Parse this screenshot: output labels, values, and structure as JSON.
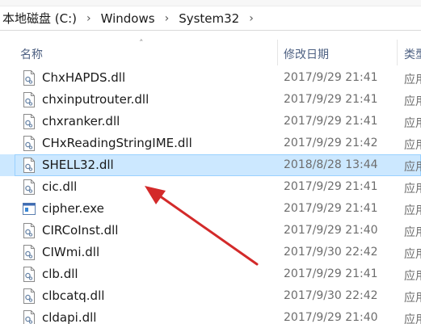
{
  "address": {
    "crumbs": [
      "本地磁盘 (C:)",
      "Windows",
      "System32"
    ]
  },
  "columns": {
    "name": "名称",
    "date": "修改日期",
    "type": "类型"
  },
  "files": [
    {
      "name": "ChxHAPDS.dll",
      "date": "2017/9/29 21:41",
      "type": "应用",
      "icon": "dll-file-icon"
    },
    {
      "name": "chxinputrouter.dll",
      "date": "2017/9/29 21:41",
      "type": "应用",
      "icon": "dll-file-icon"
    },
    {
      "name": "chxranker.dll",
      "date": "2017/9/29 21:41",
      "type": "应用",
      "icon": "dll-file-icon"
    },
    {
      "name": "CHxReadingStringIME.dll",
      "date": "2017/9/29 21:42",
      "type": "应用",
      "icon": "dll-file-icon"
    },
    {
      "name": "SHELL32.dll",
      "date": "2018/8/28 13:44",
      "type": "应用",
      "icon": "dll-file-icon",
      "selected": true
    },
    {
      "name": "cic.dll",
      "date": "2017/9/29 21:41",
      "type": "应用",
      "icon": "dll-file-icon"
    },
    {
      "name": "cipher.exe",
      "date": "2017/9/29 21:41",
      "type": "应用",
      "icon": "exe-file-icon"
    },
    {
      "name": "CIRCoInst.dll",
      "date": "2017/9/29 21:40",
      "type": "应用",
      "icon": "dll-file-icon"
    },
    {
      "name": "CIWmi.dll",
      "date": "2017/9/30 22:42",
      "type": "应用",
      "icon": "dll-file-icon"
    },
    {
      "name": "clb.dll",
      "date": "2017/9/29 21:41",
      "type": "应用",
      "icon": "dll-file-icon"
    },
    {
      "name": "clbcatq.dll",
      "date": "2017/9/30 22:42",
      "type": "应用",
      "icon": "dll-file-icon"
    },
    {
      "name": "cldapi.dll",
      "date": "2017/9/29 21:40",
      "type": "应用",
      "icon": "dll-file-icon"
    }
  ],
  "colors": {
    "selection_bg": "#cce8ff",
    "selection_border": "#99d1ff",
    "annotation_arrow": "#d32a2a",
    "header_text": "#4d6082"
  }
}
